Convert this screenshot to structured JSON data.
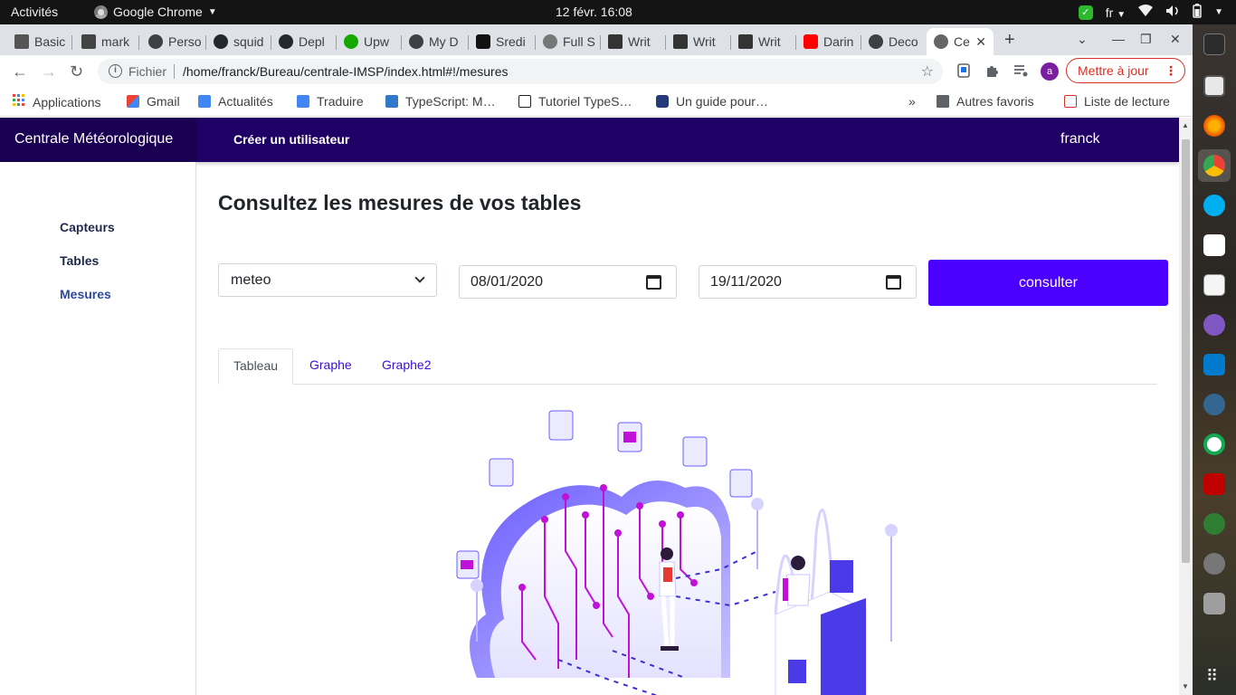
{
  "system": {
    "activities": "Activités",
    "app_name": "Google Chrome",
    "clock": "12 févr.  16:08",
    "lang": "fr"
  },
  "browser": {
    "tabs": [
      {
        "label": "Basic",
        "icon": "mail-icon"
      },
      {
        "label": "mark",
        "icon": "cube-icon"
      },
      {
        "label": "Perso",
        "icon": "site-icon"
      },
      {
        "label": "squid",
        "icon": "github-icon"
      },
      {
        "label": "Depl",
        "icon": "github-icon"
      },
      {
        "label": "Upw",
        "icon": "upwork-icon"
      },
      {
        "label": "My D",
        "icon": "site-icon"
      },
      {
        "label": "Sredi",
        "icon": "hexagon-icon"
      },
      {
        "label": "Full S",
        "icon": "globe-icon"
      },
      {
        "label": "Writ",
        "icon": "book-icon"
      },
      {
        "label": "Writ",
        "icon": "book-icon"
      },
      {
        "label": "Writ",
        "icon": "book-icon"
      },
      {
        "label": "Darin",
        "icon": "youtube-icon"
      },
      {
        "label": "Deco",
        "icon": "site-icon"
      },
      {
        "label": "Ce",
        "icon": "globe-icon"
      }
    ],
    "omnibox": {
      "scheme": "Fichier",
      "url": "/home/franck/Bureau/centrale-IMSP/index.html#!/mesures"
    },
    "profile_initial": "a",
    "update_label": "Mettre à jour",
    "bookmarks": [
      {
        "label": "Applications",
        "icon": "apps-grid-icon"
      },
      {
        "label": "Gmail",
        "icon": "gmail-icon"
      },
      {
        "label": "Actualités",
        "icon": "news-icon"
      },
      {
        "label": "Traduire",
        "icon": "translate-icon"
      },
      {
        "label": "TypeScript: M…",
        "icon": "typescript-icon"
      },
      {
        "label": "Tutoriel TypeS…",
        "icon": "terminal-icon"
      },
      {
        "label": "Un guide pour…",
        "icon": "link-icon"
      }
    ],
    "bookmarks_more": "»",
    "other_bookmarks": "Autres favoris",
    "reading_list": "Liste de lecture"
  },
  "app": {
    "brand": "Centrale Météorologique",
    "nav_create_user": "Créer un utilisateur",
    "user": "franck",
    "sidebar": [
      {
        "label": "Capteurs",
        "active": false
      },
      {
        "label": "Tables",
        "active": false
      },
      {
        "label": "Mesures",
        "active": true
      }
    ],
    "title": "Consultez les mesures de vos tables",
    "table_select": "meteo",
    "date_from": "08/01/2020",
    "date_to": "19/11/2020",
    "consult_button": "consulter",
    "tabs": [
      {
        "label": "Tableau",
        "active": true
      },
      {
        "label": "Graphe",
        "active": false
      },
      {
        "label": "Graphe2",
        "active": false
      }
    ],
    "accent": "#4b00ff",
    "navbar_color": "#1f0065"
  }
}
